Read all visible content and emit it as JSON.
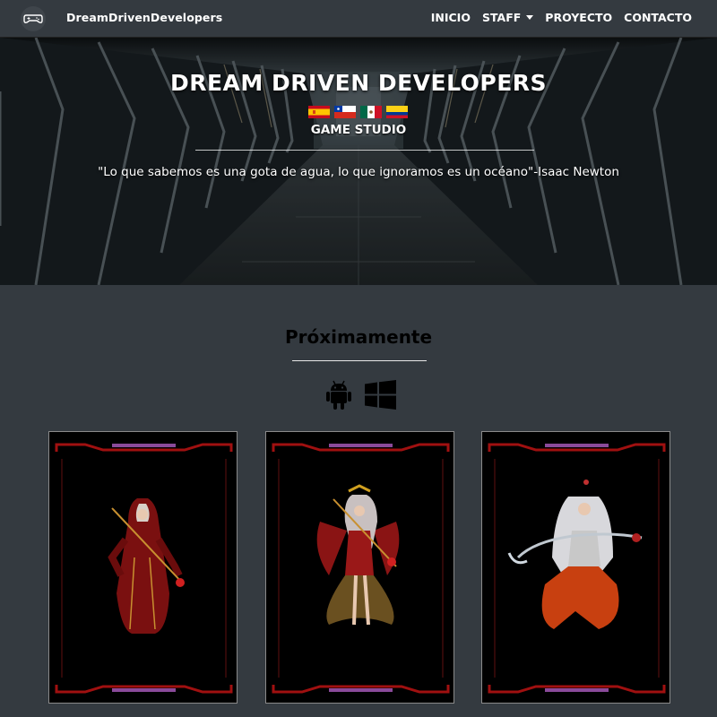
{
  "navbar": {
    "brand": "DreamDrivenDevelopers",
    "logo_icon": "gamepad-icon",
    "links": [
      {
        "label": "INICIO"
      },
      {
        "label": "STAFF",
        "dropdown": true
      },
      {
        "label": "PROYECTO"
      },
      {
        "label": "CONTACTO"
      }
    ]
  },
  "hero": {
    "title": "DREAM DRIVEN DEVELOPERS",
    "flags": [
      "spain-flag",
      "chile-flag",
      "mexico-flag",
      "colombia-flag"
    ],
    "subtitle": "GAME STUDIO",
    "quote": "\"Lo que sabemos es una gota de agua, lo que ignoramos es un océano\"-Isaac Newton"
  },
  "section": {
    "title": "Próximamente",
    "platforms": [
      "android-icon",
      "windows-icon"
    ]
  },
  "cards": [
    {
      "name": "character-card-1",
      "image": "red-hooded-sorceress-art"
    },
    {
      "name": "character-card-2",
      "image": "crowned-sorceress-art"
    },
    {
      "name": "character-card-3",
      "image": "white-haired-warrior-art"
    }
  ],
  "colors": {
    "navbar_bg": "#343a40",
    "page_bg": "#343a40",
    "section_title": "#000000",
    "card_bg": "#000000",
    "card_frame_red": "#a01010",
    "card_frame_purple": "#8a4a9a"
  }
}
